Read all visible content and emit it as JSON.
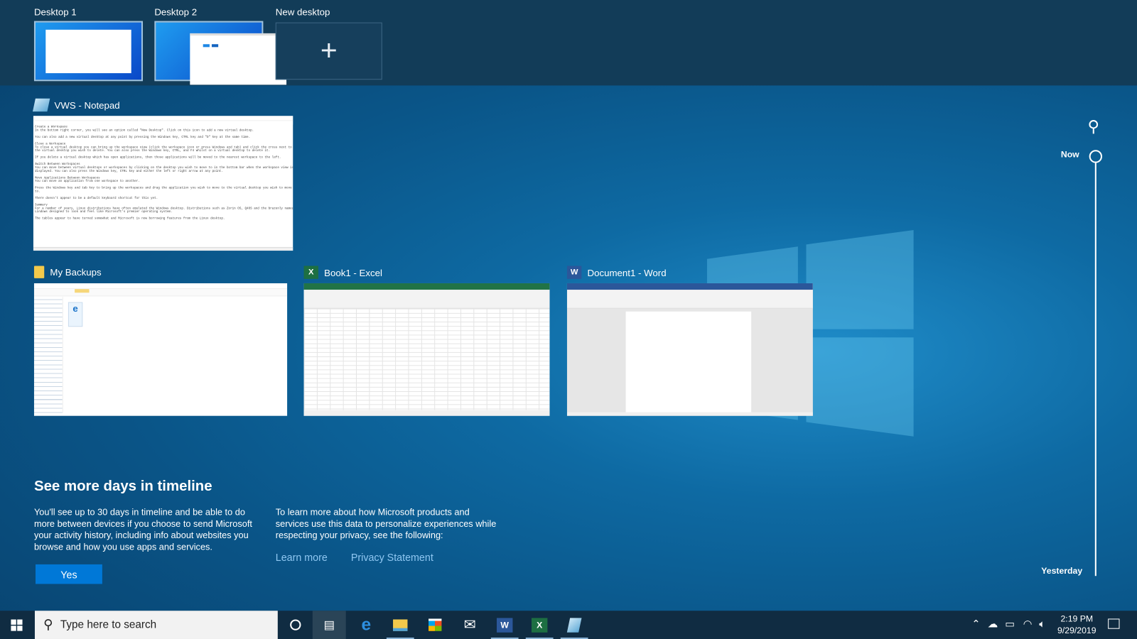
{
  "desktops": [
    {
      "label": "Desktop 1"
    },
    {
      "label": "Desktop 2"
    },
    {
      "label": "New desktop",
      "icon": "plus-icon"
    }
  ],
  "windows": [
    {
      "title": "VWS - Notepad",
      "icon": "notepad-icon"
    },
    {
      "title": "My Backups",
      "icon": "folder-icon"
    },
    {
      "title": "Book1 - Excel",
      "icon": "excel-icon"
    },
    {
      "title": "Document1 - Word",
      "icon": "word-icon"
    }
  ],
  "notepad_lines": [
    "Create a Workspace",
    "In the bottom right corner, you will see an option called \"New Desktop\". Click on this icon to add a new virtual desktop.",
    "",
    "You can also add a new virtual desktop at any point by pressing the Windows key, CTRL key and \"D\" key at the same time.",
    "",
    "Close a Workspace",
    "To close a virtual desktop you can bring up the workspace view (click the workspace icon or press Windows and tab) and click the cross next to",
    "the virtual desktop you wish to delete. You can also press the Windows key, CTRL, and F4 whilst on a virtual desktop to delete it.",
    "",
    "If you delete a virtual desktop which has open applications, then those applications will be moved to the nearest workspace to the left.",
    "",
    "Switch Between Workspaces",
    "You can move between virtual desktops or workspaces by clicking on the desktop you wish to move to in the bottom bar when the workspace view is",
    "displayed. You can also press the Windows key, CTRL key and either the left or right arrow at any point.",
    "",
    "Move Applications Between Workspaces",
    "You can move an application from one workspace to another.",
    "",
    "Press the Windows key and tab key to bring up the workspaces and drag the application you wish to move to the virtual desktop you wish to move it",
    "to.",
    "",
    "There doesn't appear to be a default keyboard shortcut for this yet.",
    "",
    "Summary",
    "For a number of years, Linux distributions have often emulated the Windows desktop. Distributions such as Zorin OS, Q4OS and the brazenly named",
    "Lindows designed to look and feel like Microsoft's premier operating system.",
    "",
    "The tables appear to have turned somewhat and Microsoft is now borrowing features from the Linux desktop."
  ],
  "timeline": {
    "now": "Now",
    "yesterday": "Yesterday",
    "search_icon": "search-icon"
  },
  "promo": {
    "heading": "See more days in timeline",
    "text1": "You'll see up to 30 days in timeline and be able to do more between devices if you choose to send Microsoft your activity history, including info about websites you browse and how you use apps and services.",
    "text2": "To learn more about how Microsoft products and services use this data to personalize experiences while respecting your privacy, see the following:",
    "learn_more": "Learn more",
    "privacy": "Privacy Statement",
    "yes": "Yes"
  },
  "taskbar": {
    "search_placeholder": "Type here to search",
    "apps": [
      "cortana-icon",
      "task-view-icon",
      "edge-icon",
      "file-explorer-icon",
      "store-icon",
      "mail-icon",
      "word-icon",
      "excel-icon",
      "notepad-icon"
    ],
    "time": "2:19 PM",
    "date": "9/29/2019"
  },
  "colors": {
    "accent": "#0078d7",
    "link": "#8fc7f2",
    "taskbar": "#102c42"
  }
}
